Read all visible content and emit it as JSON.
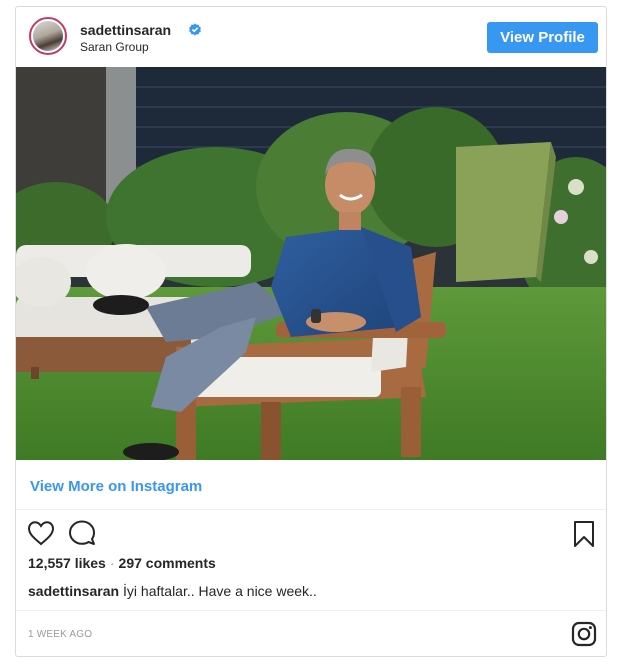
{
  "post": {
    "username": "sadettinsaran",
    "account_subtitle": "Saran Group",
    "view_profile_label": "View Profile",
    "view_more_label": "View More on Instagram",
    "likes": "12,557 likes",
    "separator": "·",
    "comments": "297 comments",
    "caption_user": "sadettinsaran",
    "caption_text": "İyi haftalar.. Have a nice week..",
    "timestamp": "1 WEEK AGO",
    "verified": true,
    "icons": [
      "heart-icon",
      "comment-icon",
      "bookmark-icon",
      "instagram-logo-icon",
      "verified-icon"
    ]
  },
  "colors": {
    "accent": "#3897f0",
    "text": "#262626",
    "muted": "#999999",
    "border": "#dbdbdb"
  }
}
